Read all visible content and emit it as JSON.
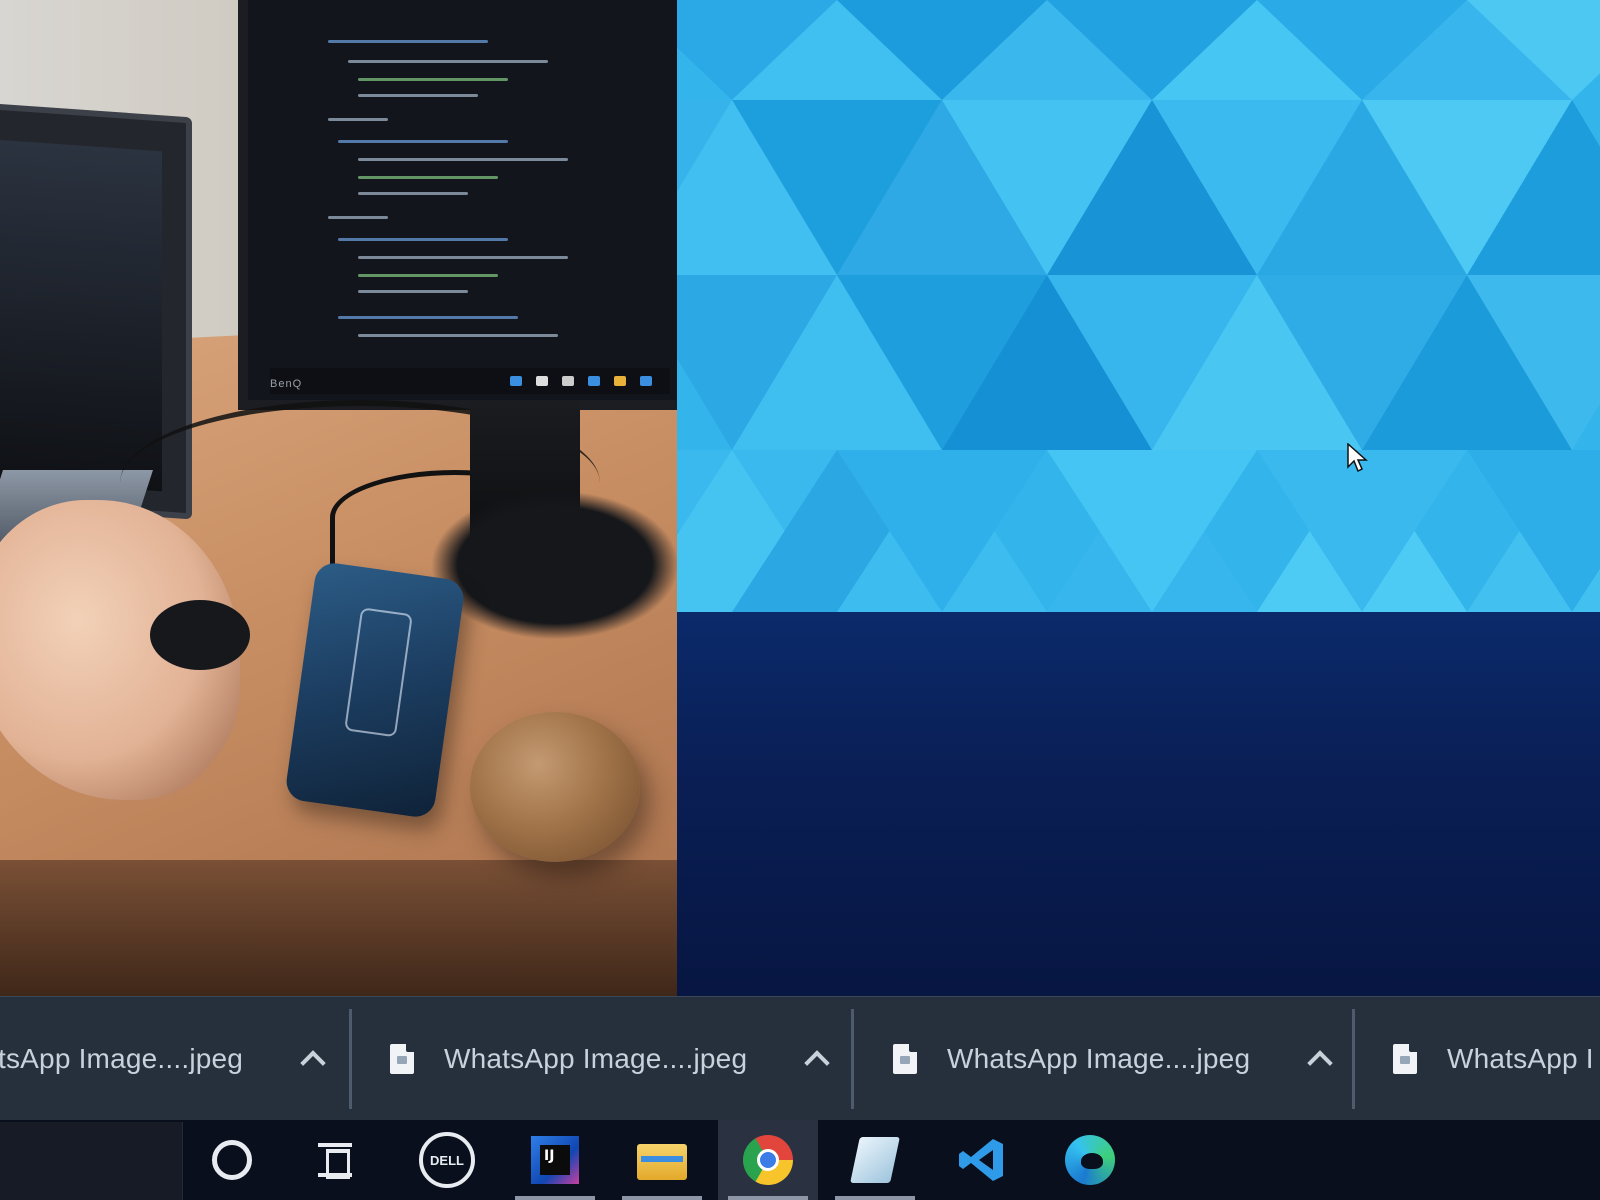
{
  "downloads": [
    {
      "name": "tsApp Image....jpeg",
      "icon": "file-icon"
    },
    {
      "name": "WhatsApp Image....jpeg",
      "icon": "file-icon"
    },
    {
      "name": "WhatsApp Image....jpeg",
      "icon": "file-icon"
    },
    {
      "name": "WhatsApp I",
      "icon": "file-icon"
    }
  ],
  "photo": {
    "monitor_brand": "BenQ"
  },
  "taskbar": {
    "apps": [
      {
        "name": "cortana-icon",
        "active": false
      },
      {
        "name": "task-view-icon",
        "active": false
      },
      {
        "name": "dell-icon",
        "active": false
      },
      {
        "name": "intellij-idea-icon",
        "label": "IJ",
        "active": false
      },
      {
        "name": "file-explorer-icon",
        "active": false
      },
      {
        "name": "chrome-icon",
        "active": true
      },
      {
        "name": "notes-app-icon",
        "active": false
      },
      {
        "name": "vscode-icon",
        "active": false
      },
      {
        "name": "edge-icon",
        "active": false
      }
    ]
  },
  "dell_label": "DELL",
  "intellij_label": "IJ",
  "colors": {
    "wallpaper": "#33b5ec",
    "shelf": "#26303d",
    "taskbar": "#0a0f1d",
    "lower_desktop": "#0a1f56"
  }
}
